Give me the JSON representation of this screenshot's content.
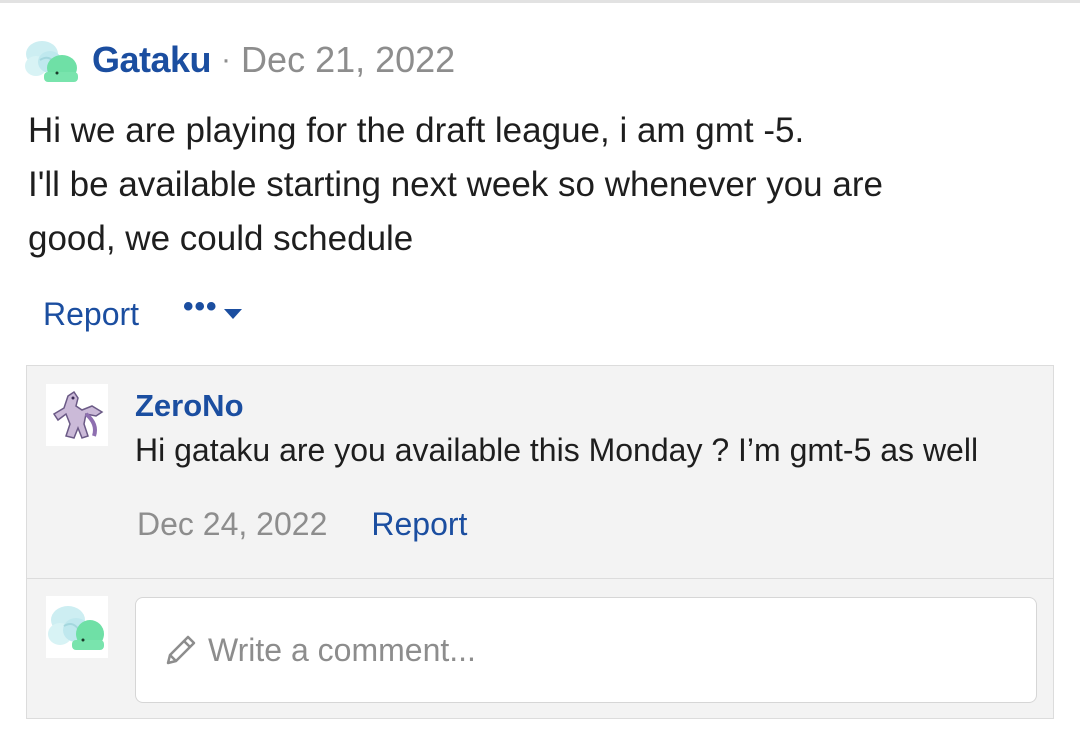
{
  "post": {
    "author": "Gataku",
    "separator": "·",
    "date": "Dec 21, 2022",
    "lines": [
      "Hi we are playing for the draft league, i am gmt -5.",
      "I'll be available starting next week so whenever you are",
      "good, we could schedule"
    ],
    "report_label": "Report",
    "more_label": "•••"
  },
  "reply": {
    "author": "ZeroNo",
    "text": "Hi gataku are you available this Monday ? I’m gmt-5 as well",
    "date": "Dec 24, 2022",
    "report_label": "Report"
  },
  "comment": {
    "placeholder": "Write a comment..."
  },
  "colors": {
    "link": "#1b4ea0",
    "muted": "#8d8d8d",
    "text": "#1e1e1e",
    "panel": "#f3f3f3"
  },
  "icons": {
    "avatar_main": "cloud-pokemon-avatar",
    "avatar_reply": "mewtwo-sprite-avatar",
    "more": "chevron-down-icon",
    "pencil": "pencil-icon"
  }
}
